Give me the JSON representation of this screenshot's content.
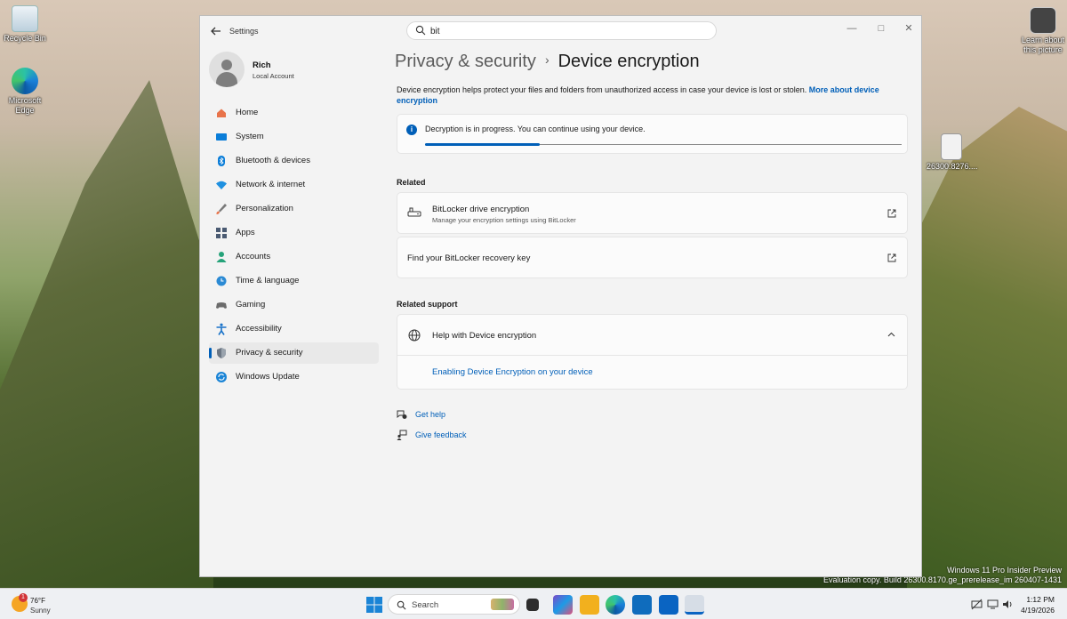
{
  "desktop": {
    "icons": [
      {
        "label": "Recycle Bin"
      },
      {
        "label": "Microsoft Edge"
      },
      {
        "label": "26300.8276...."
      },
      {
        "label": "Learn about this picture"
      }
    ],
    "watermark": {
      "line1": "Windows 11 Pro Insider Preview",
      "line2": "Evaluation copy. Build 26300.8170.ge_prerelease_im 260407-1431"
    }
  },
  "window": {
    "app_title": "Settings",
    "search": {
      "value": "bit",
      "placeholder": ""
    }
  },
  "profile": {
    "name": "Rich",
    "account_type": "Local Account"
  },
  "nav": {
    "items": [
      {
        "label": "Home",
        "icon": "home-icon",
        "color": "#e8734a"
      },
      {
        "label": "System",
        "icon": "display-icon",
        "color": "#0a7dd8"
      },
      {
        "label": "Bluetooth & devices",
        "icon": "bluetooth-icon",
        "color": "#0a7dd8"
      },
      {
        "label": "Network & internet",
        "icon": "wifi-icon",
        "color": "#1e90e0"
      },
      {
        "label": "Personalization",
        "icon": "brush-icon",
        "color": "#e8734a"
      },
      {
        "label": "Apps",
        "icon": "apps-icon",
        "color": "#4a5a72"
      },
      {
        "label": "Accounts",
        "icon": "person-icon",
        "color": "#26a37a"
      },
      {
        "label": "Time & language",
        "icon": "globe-clock-icon",
        "color": "#2b8ad4"
      },
      {
        "label": "Gaming",
        "icon": "controller-icon",
        "color": "#6b6b6b"
      },
      {
        "label": "Accessibility",
        "icon": "accessibility-icon",
        "color": "#1a73c9"
      },
      {
        "label": "Privacy & security",
        "icon": "shield-icon",
        "color": "#6d7784"
      },
      {
        "label": "Windows Update",
        "icon": "update-icon",
        "color": "#1a84d6"
      }
    ],
    "active_index": 10
  },
  "page": {
    "breadcrumb_parent": "Privacy & security",
    "breadcrumb_separator": "›",
    "title": "Device encryption",
    "description": "Device encryption helps protect your files and folders from unauthorized access in case your device is lost or stolen.",
    "more_link": "More about device encryption",
    "status_message": "Decryption is in progress. You can continue using your device.",
    "progress": 0.24,
    "related_heading": "Related",
    "bitlocker_title": "BitLocker drive encryption",
    "bitlocker_sub": "Manage your encryption settings using BitLocker",
    "recovery_key": "Find your BitLocker recovery key",
    "related_support_heading": "Related support",
    "help_expander": "Help with Device encryption",
    "help_link": "Enabling Device Encryption on your device",
    "get_help": "Get help",
    "give_feedback": "Give feedback"
  },
  "taskbar": {
    "weather_temp": "76°F",
    "weather_cond": "Sunny",
    "weather_badge": "1",
    "search_label": "Search",
    "time": "1:12 PM",
    "date": "4/19/2026"
  },
  "colors": {
    "accent": "#005fb8"
  }
}
